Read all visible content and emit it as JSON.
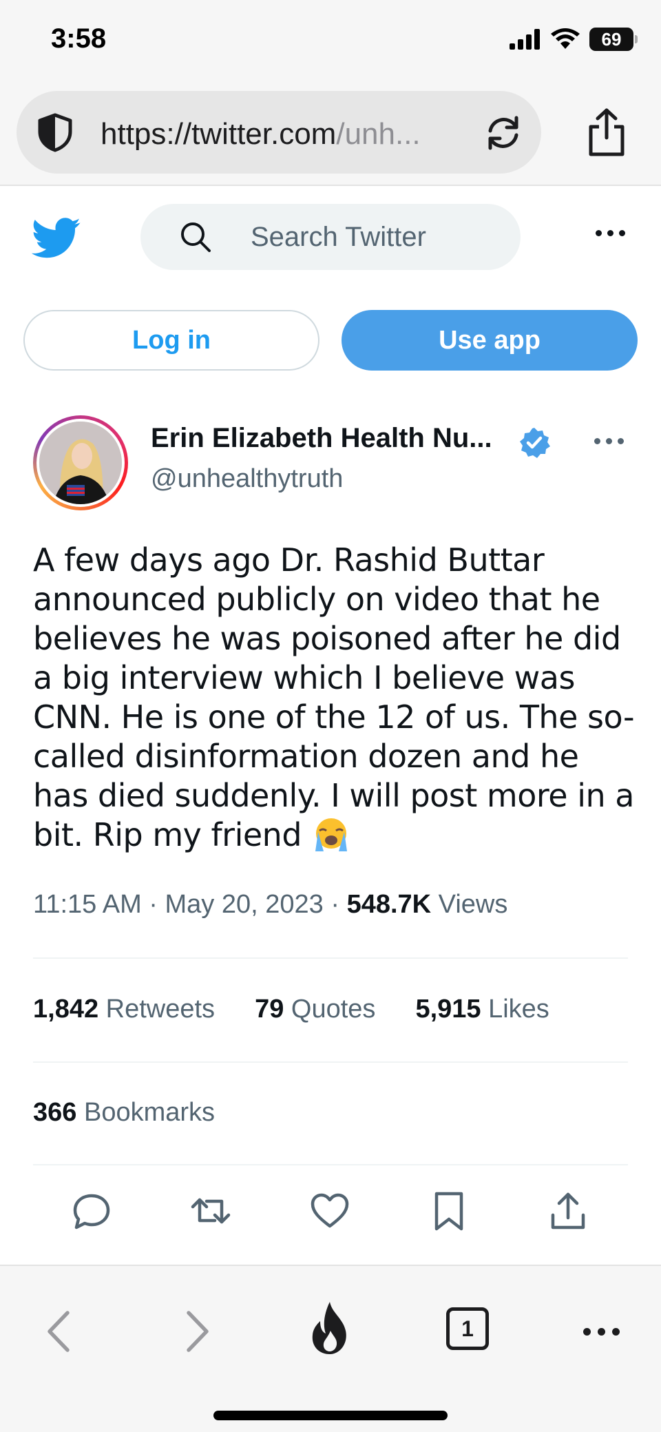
{
  "status_bar": {
    "time": "3:58",
    "battery": "69"
  },
  "browser": {
    "url_primary": "https://twitter.com",
    "url_faded": "/unh...",
    "tab_count": "1"
  },
  "twitter": {
    "search_placeholder": "Search Twitter",
    "login_label": "Log in",
    "use_app_label": "Use app"
  },
  "tweet": {
    "author_name": "Erin Elizabeth Health Nu...",
    "author_handle": "@unhealthytruth",
    "text": "A few days ago Dr. Rashid Buttar announced publicly on video that he believes he was poisoned after he did a big interview which I believe was CNN. He is one of the 12 of us. The so-called disinformation dozen and he has died suddenly. I will post more in a bit. Rip my friend",
    "emoji": "loudly-crying-face",
    "time": "11:15 AM",
    "date": "May 20, 2023",
    "separator": "·",
    "views_count": "548.7K",
    "views_label": "Views",
    "retweets_count": "1,842",
    "retweets_label": "Retweets",
    "quotes_count": "79",
    "quotes_label": "Quotes",
    "likes_count": "5,915",
    "likes_label": "Likes",
    "bookmarks_count": "366",
    "bookmarks_label": "Bookmarks"
  },
  "colors": {
    "twitter_blue": "#1d9bf0",
    "use_app_bg": "#4a9fe8",
    "secondary_text": "#536471",
    "verified": "#4a9fe8"
  },
  "icons": [
    "shield-icon",
    "reload-icon",
    "share-icon",
    "twitter-bird-icon",
    "search-icon",
    "more-icon",
    "verified-badge-icon",
    "reply-icon",
    "retweet-icon",
    "like-icon",
    "bookmark-icon",
    "share-tweet-icon",
    "back-icon",
    "forward-icon",
    "fire-icon",
    "tabs-icon"
  ]
}
